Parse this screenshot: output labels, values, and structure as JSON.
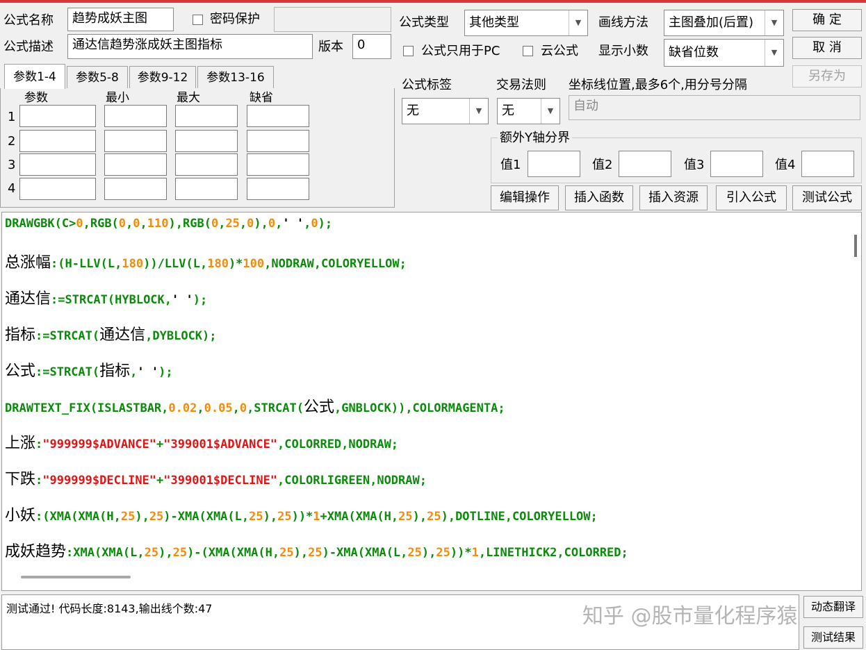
{
  "form": {
    "name_label": "公式名称",
    "name_value": "趋势成妖主图",
    "password_label": "密码保护",
    "desc_label": "公式描述",
    "desc_value": "通达信趋势涨成妖主图指标",
    "version_label": "版本",
    "version_value": "0",
    "type_label": "公式类型",
    "type_value": "其他类型",
    "draw_label": "画线方法",
    "draw_value": "主图叠加(后置)",
    "pc_only_label": "公式只用于PC",
    "cloud_label": "云公式",
    "decimal_label": "显示小数",
    "decimal_value": "缺省位数",
    "tag_label": "公式标签",
    "tag_value": "无",
    "rule_label": "交易法则",
    "rule_value": "无",
    "coord_label": "坐标线位置,最多6个,用分号分隔",
    "coord_placeholder": "自动",
    "yaxis_group": "额外Y轴分界",
    "val1": "值1",
    "val2": "值2",
    "val3": "值3",
    "val4": "值4"
  },
  "buttons": {
    "ok": "确  定",
    "cancel": "取  消",
    "save_as": "另存为",
    "edit": "编辑操作",
    "insert_func": "插入函数",
    "insert_res": "插入资源",
    "import": "引入公式",
    "test": "测试公式",
    "translate": "动态翻译",
    "test_result": "测试结果"
  },
  "params": {
    "tabs": [
      "参数1-4",
      "参数5-8",
      "参数9-12",
      "参数13-16"
    ],
    "headers": [
      "参数",
      "最小",
      "最大",
      "缺省"
    ],
    "rows": [
      "1",
      "2",
      "3",
      "4"
    ]
  },
  "code_lines": [
    "DRAWGBK(C>0,RGB(0,0,110),RGB(0,25,0),0,' ',0);",
    "总涨幅:(H-LLV(L,180))/LLV(L,180)*100,NODRAW,COLORYELLOW;",
    "通达信:=STRCAT(HYBLOCK,' ');",
    "指标:=STRCAT(通达信,DYBLOCK);",
    "公式:=STRCAT(指标,' ');",
    "DRAWTEXT_FIX(ISLASTBAR,0.02,0.05,0,STRCAT(公式,GNBLOCK)),COLORMAGENTA;",
    "上涨:\"999999$ADVANCE\"+\"399001$ADVANCE\",COLORRED,NODRAW;",
    "下跌:\"999999$DECLINE\"+\"399001$DECLINE\",COLORLIGREEN,NODRAW;",
    "小妖:(XMA(XMA(H,25),25)-XMA(XMA(L,25),25))*1+XMA(XMA(H,25),25),DOTLINE,COLORYELLOW;",
    "成妖趋势:XMA(XMA(L,25),25)-(XMA(XMA(H,25),25)-XMA(XMA(L,25),25))*1,LINETHICK2,COLORRED;"
  ],
  "output": {
    "message": "测试通过! 代码长度:8143,输出线个数:47"
  },
  "watermark": "知乎 @股市量化程序猿",
  "colors": {
    "keyword": "#0b8a0b",
    "number": "#f28c0a",
    "string": "#e01414",
    "title_bar": "#d9383a"
  }
}
